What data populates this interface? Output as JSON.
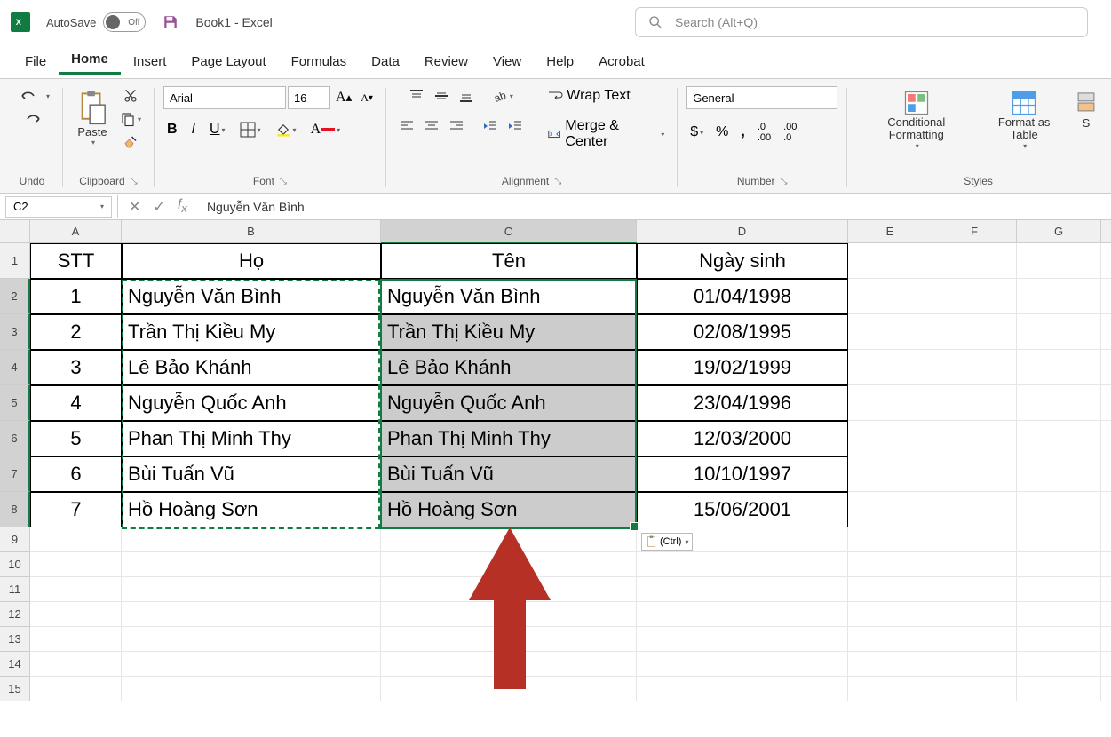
{
  "titlebar": {
    "autosave_label": "AutoSave",
    "autosave_state": "Off",
    "doc_title": "Book1  -  Excel",
    "search_placeholder": "Search (Alt+Q)"
  },
  "tabs": [
    "File",
    "Home",
    "Insert",
    "Page Layout",
    "Formulas",
    "Data",
    "Review",
    "View",
    "Help",
    "Acrobat"
  ],
  "active_tab": "Home",
  "ribbon": {
    "undo_label": "Undo",
    "clipboard_label": "Clipboard",
    "paste_label": "Paste",
    "font_label": "Font",
    "font_name": "Arial",
    "font_size": "16",
    "alignment_label": "Alignment",
    "wrap_text": "Wrap Text",
    "merge_center": "Merge & Center",
    "number_label": "Number",
    "number_format": "General",
    "styles_label": "Styles",
    "cond_fmt": "Conditional Formatting",
    "fmt_table": "Format as Table",
    "cell_styles_s": "S"
  },
  "formula_bar": {
    "name_box": "C2",
    "formula": "Nguyễn Văn Bình"
  },
  "columns": [
    "A",
    "B",
    "C",
    "D",
    "E",
    "F",
    "G"
  ],
  "row_headers": [
    "1",
    "2",
    "3",
    "4",
    "5",
    "6",
    "7",
    "8",
    "9",
    "10",
    "11",
    "12",
    "13",
    "14",
    "15"
  ],
  "sheet": {
    "header": {
      "A": "STT",
      "B": "Họ",
      "C": "Tên",
      "D": "Ngày sinh"
    },
    "rows": [
      {
        "A": "1",
        "B": "Nguyễn Văn Bình",
        "C": "Nguyễn Văn Bình",
        "D": "01/04/1998"
      },
      {
        "A": "2",
        "B": "Trần Thị Kiều My",
        "C": "Trần Thị Kiều My",
        "D": "02/08/1995"
      },
      {
        "A": "3",
        "B": "Lê Bảo Khánh",
        "C": "Lê Bảo Khánh",
        "D": "19/02/1999"
      },
      {
        "A": "4",
        "B": "Nguyễn Quốc Anh",
        "C": "Nguyễn Quốc Anh",
        "D": "23/04/1996"
      },
      {
        "A": "5",
        "B": "Phan Thị Minh Thy",
        "C": "Phan Thị Minh Thy",
        "D": "12/03/2000"
      },
      {
        "A": "6",
        "B": "Bùi Tuấn Vũ",
        "C": "Bùi Tuấn Vũ",
        "D": "10/10/1997"
      },
      {
        "A": "7",
        "B": "Hồ Hoàng Sơn",
        "C": "Hồ Hoàng Sơn",
        "D": "15/06/2001"
      }
    ]
  },
  "paste_options_label": "(Ctrl)"
}
